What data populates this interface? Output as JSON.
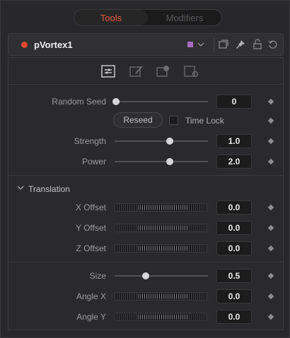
{
  "tabs": [
    {
      "label": "Tools",
      "active": true
    },
    {
      "label": "Modifiers",
      "active": false
    }
  ],
  "header": {
    "tool_name": "pVortex1",
    "color_swatch": "#a66bbd",
    "icons": [
      "color-dropdown-chevron",
      "view-window",
      "pin",
      "lock",
      "reset"
    ]
  },
  "panel_icons": [
    "controls",
    "brush",
    "mask",
    "settings"
  ],
  "controls": {
    "random_seed": {
      "label": "Random Seed",
      "value": "0",
      "slider_fraction": 0.0
    },
    "reseed_label": "Reseed",
    "time_lock_label": "Time Lock",
    "strength": {
      "label": "Strength",
      "value": "1.0",
      "slider_fraction": 0.6
    },
    "power": {
      "label": "Power",
      "value": "2.0",
      "slider_fraction": 0.6
    }
  },
  "translation": {
    "section_label": "Translation",
    "x_offset": {
      "label": "X Offset",
      "value": "0.0"
    },
    "y_offset": {
      "label": "Y Offset",
      "value": "0.0"
    },
    "z_offset": {
      "label": "Z Offset",
      "value": "0.0"
    }
  },
  "size": {
    "label": "Size",
    "value": "0.5",
    "slider_fraction": 0.35
  },
  "angle_x": {
    "label": "Angle X",
    "value": "0.0"
  },
  "angle_y": {
    "label": "Angle Y",
    "value": "0.0"
  },
  "colors": {
    "accent": "#e25a3b",
    "record_dot": "#e1472f"
  }
}
